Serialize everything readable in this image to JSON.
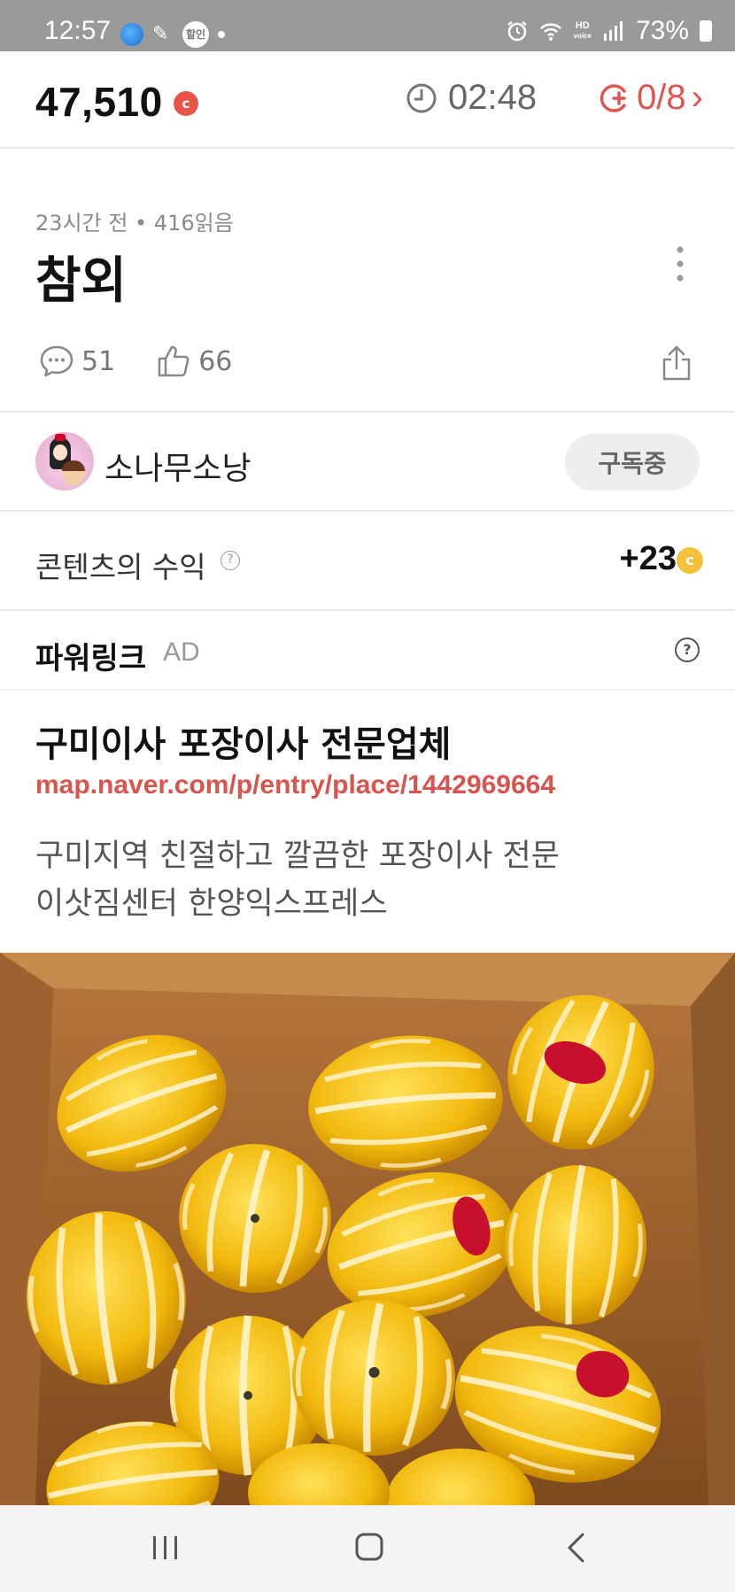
{
  "status_bar": {
    "time": "12:57",
    "badge": "할인",
    "network": "HD",
    "network_sub": "voice",
    "battery": "73%"
  },
  "header": {
    "points": "47,510",
    "points_coin": "c",
    "timer": "02:48",
    "counter": "0/8",
    "counter_chevron": "›",
    "accent_color": "#e05550"
  },
  "article": {
    "meta": "23시간 전 • 416읽음",
    "title": "참외",
    "comments": "51",
    "likes": "66"
  },
  "author": {
    "name": "소나무소낭",
    "subscribe_label": "구독중"
  },
  "earnings": {
    "label": "콘텐츠의 수익",
    "help": "?",
    "value": "+23",
    "coin": "c"
  },
  "powerlink": {
    "title": "파워링크",
    "ad_label": "AD",
    "help": "?",
    "ad_title": "구미이사 포장이사 전문업체",
    "ad_url": "map.naver.com/p/entry/place/1442969664",
    "ad_desc_line1": "구미지역 친절하고 깔끔한 포장이사 전문",
    "ad_desc_line2": "이삿짐센터 한양익스프레스"
  },
  "photo": {
    "subject": "box of yellow korean melons (참외)"
  },
  "icons": {
    "clock": "clock-icon",
    "coin_plus": "coin-plus-icon",
    "comment": "comment-icon",
    "like": "thumbs-up-icon",
    "share": "share-icon",
    "more": "more-vertical-icon"
  }
}
